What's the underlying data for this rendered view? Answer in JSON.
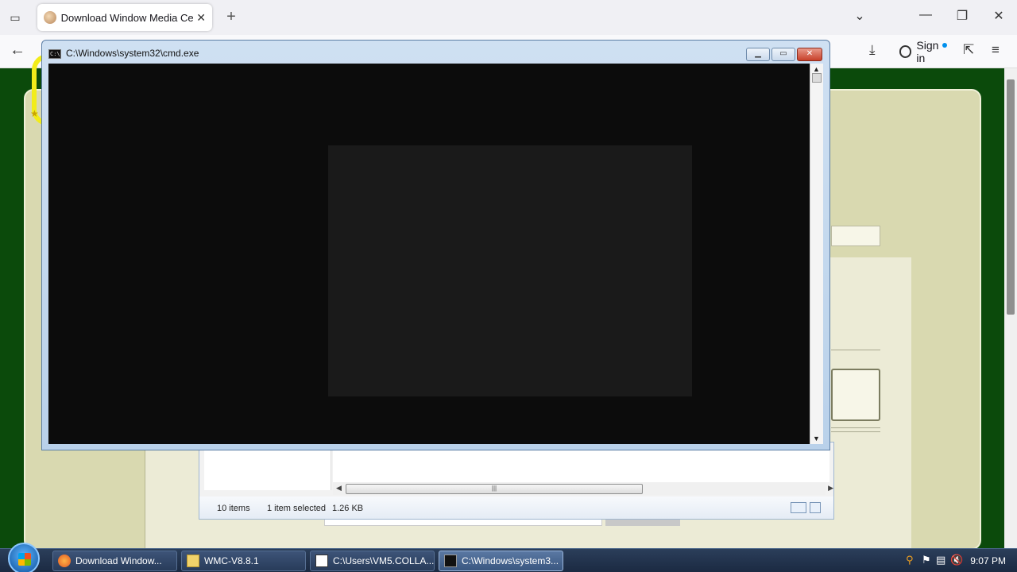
{
  "browser": {
    "tab_title": "Download Window Media Cent",
    "tab_close": "✕",
    "new_tab": "+",
    "tabs_menu": "⌄",
    "minimize": "—",
    "restore": "❐",
    "close": "✕",
    "back": "←",
    "downloads_icon": "⤓",
    "sign_in": "Sign in",
    "extensions_icon": "⇱",
    "menu_icon": "≡"
  },
  "cmd": {
    "title": "C:\\Windows\\system32\\cmd.exe",
    "icon_text": "C:\\",
    "btn_minimize": "▁",
    "btn_maximize": "▭",
    "btn_close": "✕"
  },
  "explorer": {
    "items_count": "10 items",
    "selected": "1 item selected",
    "size": "1.26 KB"
  },
  "taskbar": {
    "items": [
      {
        "label": "Download Window..."
      },
      {
        "label": "WMC-V8.8.1"
      },
      {
        "label": "C:\\Users\\VM5.COLLA..."
      },
      {
        "label": "C:\\Windows\\system3..."
      }
    ],
    "clock": "9:07 PM"
  },
  "colors": {
    "page_bg": "#0b4a0b",
    "panel": "#d9d9b0",
    "taskbar": "#1b2a42"
  }
}
